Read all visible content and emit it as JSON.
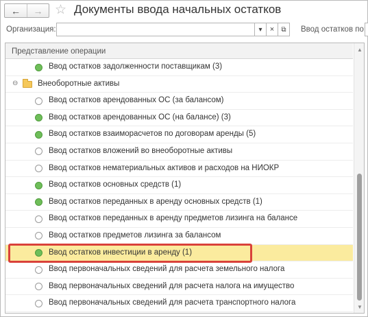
{
  "window": {
    "title": "Документы ввода начальных остатков"
  },
  "nav": {
    "back_icon": "←",
    "forward_icon": "→",
    "favorite_icon": "☆"
  },
  "filter": {
    "organization_label": "Организация:",
    "organization_value": "",
    "dropdown_icon": "▾",
    "clear_icon": "×",
    "open_icon": "⧉",
    "input_date_label": "Ввод остатков по:"
  },
  "table": {
    "column_header": "Представление операции",
    "rows": [
      {
        "text": "Ввод остатков задолженности поставщикам (3)",
        "status": "filled"
      },
      {
        "text": "Внеоборотные активы",
        "group": true,
        "toggle": "⊖"
      },
      {
        "text": "Ввод остатков арендованных ОС (за балансом)",
        "status": "empty"
      },
      {
        "text": "Ввод остатков арендованных ОС (на балансе) (3)",
        "status": "filled"
      },
      {
        "text": "Ввод остатков взаиморасчетов по договорам аренды (5)",
        "status": "filled"
      },
      {
        "text": "Ввод остатков вложений во внеоборотные активы",
        "status": "empty"
      },
      {
        "text": "Ввод остатков нематериальных активов и расходов на НИОКР",
        "status": "empty"
      },
      {
        "text": "Ввод остатков основных средств (1)",
        "status": "filled"
      },
      {
        "text": "Ввод остатков переданных в аренду основных средств (1)",
        "status": "filled"
      },
      {
        "text": "Ввод остатков переданных в аренду предметов лизинга на балансе",
        "status": "empty"
      },
      {
        "text": "Ввод остатков предметов лизинга за балансом",
        "status": "empty"
      },
      {
        "text": "Ввод остатков инвестиции в аренду (1)",
        "status": "filled",
        "selected": true
      },
      {
        "text": "Ввод первоначальных сведений для расчета земельного налога",
        "status": "empty"
      },
      {
        "text": "Ввод первоначальных сведений для расчета налога на имущество",
        "status": "empty"
      },
      {
        "text": "Ввод первоначальных сведений для расчета транспортного налога",
        "status": "empty"
      }
    ]
  },
  "colors": {
    "selected_row": "#fbeb9e",
    "highlight_border": "#d9413a",
    "status_filled": "#6fbe5a"
  }
}
